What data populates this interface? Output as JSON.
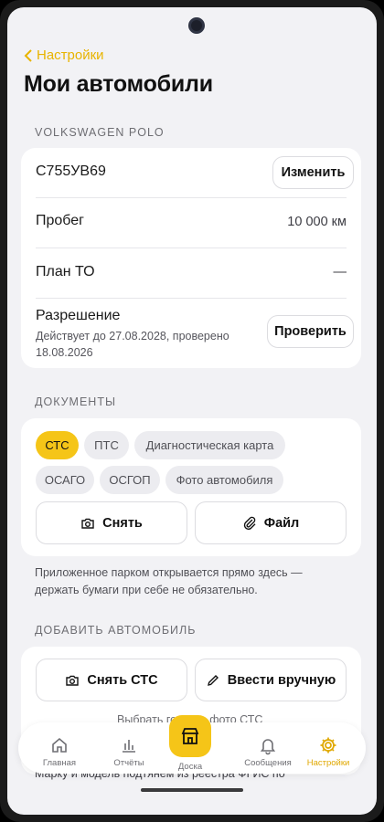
{
  "nav": {
    "back_label": "Настройки"
  },
  "page": {
    "title": "Мои автомобили"
  },
  "vehicle": {
    "section_label": "VOLKSWAGEN POLO",
    "plate": "С755УВ69",
    "edit_button": "Изменить",
    "mileage_label": "Пробег",
    "mileage_value": "10 000 км",
    "service_label": "План ТО",
    "service_value": "—",
    "permit_label": "Разрешение",
    "permit_detail": "Действует до 27.08.2028, проверено 18.08.2026",
    "check_button": "Проверить"
  },
  "documents": {
    "section_label": "ДОКУМЕНТЫ",
    "chips": [
      "СТС",
      "ПТС",
      "Диагностическая карта",
      "ОСАГО",
      "ОСГОП",
      "Фото автомобиля"
    ],
    "active_chip": "СТС",
    "photo_button": "Снять",
    "file_button": "Файл",
    "note": "Приложенное парком открывается прямо здесь — держать бумаги при себе не обязательно."
  },
  "add_vehicle": {
    "section_label": "ДОБАВИТЬ АВТОМОБИЛЬ",
    "scan_button": "Снять СТС",
    "manual_button": "Ввести вручную",
    "hint_partial": "Выбрать готовое фото СТС",
    "footer_partial": "Марку и модель подтянем из реестра ФГИС по"
  },
  "tabbar": {
    "items": [
      {
        "label": "Главная",
        "icon": "home-icon"
      },
      {
        "label": "Отчёты",
        "icon": "chart-icon"
      },
      {
        "label": "Доска",
        "icon": "store-icon"
      },
      {
        "label": "Сообщения",
        "icon": "bell-icon"
      },
      {
        "label": "Настройки",
        "icon": "gear-icon"
      }
    ],
    "active": "Настройки"
  },
  "colors": {
    "accent": "#f5c518",
    "accent_text": "#e8b400",
    "background": "#f2f2f5",
    "card": "#ffffff"
  }
}
